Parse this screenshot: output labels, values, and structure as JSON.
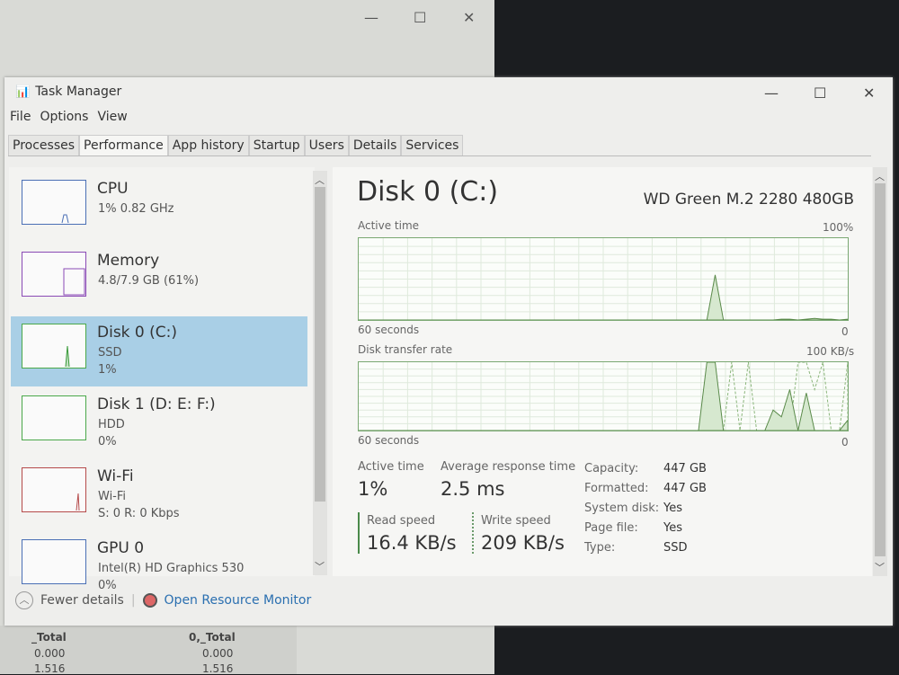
{
  "window": {
    "title": "Task Manager",
    "minimize": "—",
    "maximize": "☐",
    "close": "✕"
  },
  "menu": [
    "File",
    "Options",
    "View"
  ],
  "tabs": [
    "Processes",
    "Performance",
    "App history",
    "Startup",
    "Users",
    "Details",
    "Services"
  ],
  "active_tab": "Performance",
  "sidebar": {
    "items": [
      {
        "name": "CPU",
        "line1": "1% 0.82 GHz",
        "line2": "",
        "color": "#4a6fb5"
      },
      {
        "name": "Memory",
        "line1": "4.8/7.9 GB (61%)",
        "line2": "",
        "color": "#8a4ab5"
      },
      {
        "name": "Disk 0 (C:)",
        "line1": "SSD",
        "line2": "1%",
        "color": "#4aa84a"
      },
      {
        "name": "Disk 1 (D: E: F:)",
        "line1": "HDD",
        "line2": "0%",
        "color": "#4aa84a"
      },
      {
        "name": "Wi-Fi",
        "line1": "Wi-Fi",
        "line2": "S: 0 R: 0 Kbps",
        "color": "#b54a4a"
      },
      {
        "name": "GPU 0",
        "line1": "Intel(R) HD Graphics 530",
        "line2": "0%",
        "color": "#4a6fb5"
      }
    ],
    "selected": "Disk 0 (C:)"
  },
  "footer": {
    "fewer_details": "Fewer details",
    "resource_monitor": "Open Resource Monitor"
  },
  "detail": {
    "title": "Disk 0 (C:)",
    "model": "WD Green M.2 2280 480GB",
    "active_chart": {
      "label": "Active time",
      "max": "100%",
      "xlabel": "60 seconds",
      "min": "0"
    },
    "transfer_chart": {
      "label": "Disk transfer rate",
      "max": "100 KB/s",
      "xlabel": "60 seconds",
      "min": "0"
    },
    "stats": {
      "active_time_label": "Active time",
      "active_time": "1%",
      "avg_resp_label": "Average response time",
      "avg_resp": "2.5 ms",
      "read_label": "Read speed",
      "read": "16.4 KB/s",
      "write_label": "Write speed",
      "write": "209 KB/s"
    },
    "props": [
      {
        "k": "Capacity:",
        "v": "447 GB"
      },
      {
        "k": "Formatted:",
        "v": "447 GB"
      },
      {
        "k": "System disk:",
        "v": "Yes"
      },
      {
        "k": "Page file:",
        "v": "Yes"
      },
      {
        "k": "Type:",
        "v": "SSD"
      }
    ]
  },
  "chart_data": [
    {
      "type": "area",
      "title": "Active time",
      "ylim": [
        0,
        100
      ],
      "xlabel": "60 seconds",
      "values": [
        0,
        0,
        0,
        0,
        0,
        0,
        0,
        0,
        0,
        0,
        0,
        0,
        0,
        0,
        0,
        0,
        0,
        0,
        0,
        0,
        0,
        0,
        0,
        0,
        0,
        0,
        0,
        0,
        0,
        0,
        0,
        0,
        0,
        0,
        0,
        0,
        0,
        0,
        0,
        0,
        0,
        0,
        0,
        55,
        0,
        0,
        0,
        0,
        0,
        0,
        0,
        1,
        1,
        0,
        1,
        2,
        1,
        1,
        0,
        1
      ]
    },
    {
      "type": "area",
      "title": "Disk transfer rate",
      "ylim": [
        0,
        100
      ],
      "xlabel": "60 seconds",
      "series": [
        {
          "values": [
            0,
            0,
            0,
            0,
            0,
            0,
            0,
            0,
            0,
            0,
            0,
            0,
            0,
            0,
            0,
            0,
            0,
            0,
            0,
            0,
            0,
            0,
            0,
            0,
            0,
            0,
            0,
            0,
            0,
            0,
            0,
            0,
            0,
            0,
            0,
            0,
            0,
            0,
            0,
            0,
            0,
            0,
            100,
            100,
            0,
            0,
            0,
            0,
            0,
            0,
            30,
            20,
            60,
            0,
            55,
            0,
            0,
            0,
            0,
            15
          ]
        },
        {
          "values": [
            0,
            0,
            0,
            0,
            0,
            0,
            0,
            0,
            0,
            0,
            0,
            0,
            0,
            0,
            0,
            0,
            0,
            0,
            0,
            0,
            0,
            0,
            0,
            0,
            0,
            0,
            0,
            0,
            0,
            0,
            0,
            0,
            0,
            0,
            0,
            0,
            0,
            0,
            0,
            0,
            0,
            0,
            0,
            0,
            0,
            100,
            0,
            100,
            0,
            0,
            0,
            0,
            0,
            100,
            100,
            60,
            100,
            0,
            0,
            100
          ]
        }
      ]
    }
  ],
  "background": {
    "col1_header": "_Total",
    "col2_header": "0,_Total",
    "rows": [
      [
        "0.000",
        "0.000"
      ],
      [
        "1.516",
        "1.516"
      ]
    ]
  }
}
